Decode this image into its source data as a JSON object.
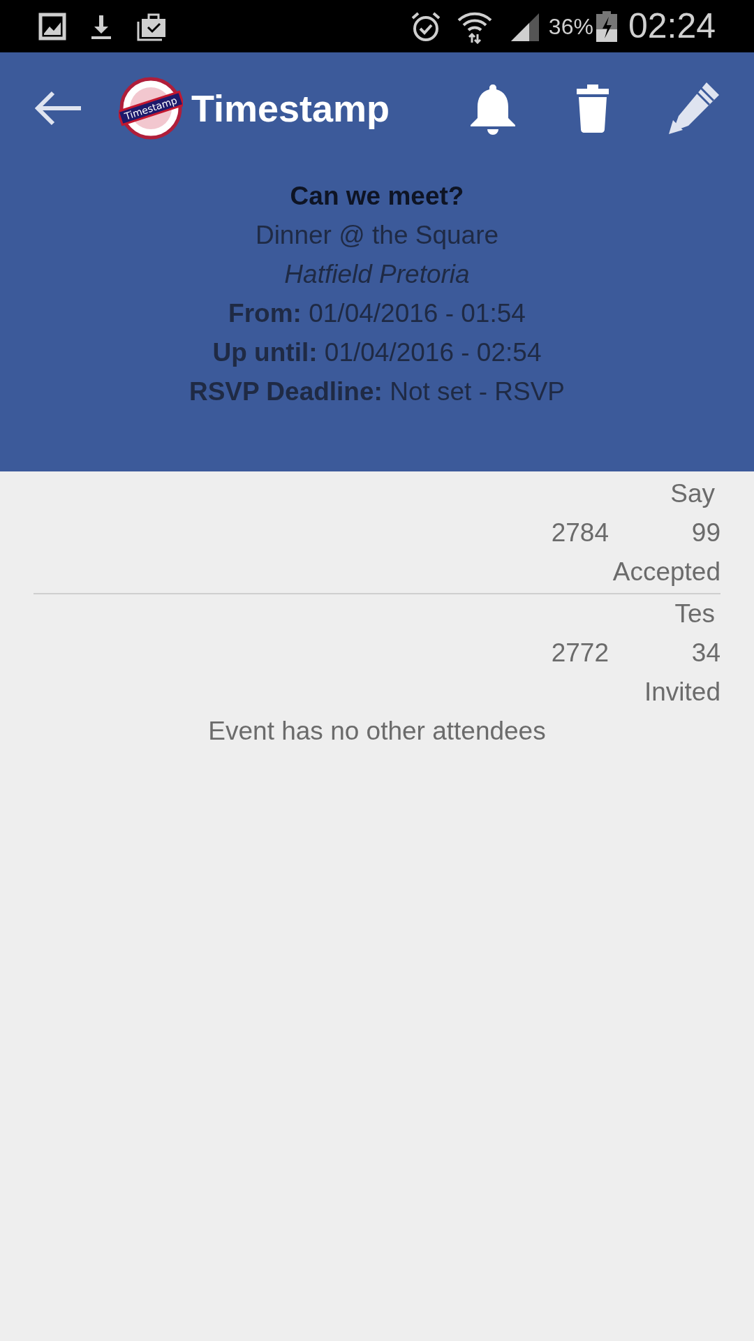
{
  "status_bar": {
    "battery": "36%",
    "time": "02:24"
  },
  "toolbar": {
    "logo_text": "Timestamp",
    "title": "Timestamp"
  },
  "event": {
    "question": "Can we meet?",
    "name": "Dinner @ the Square",
    "location": "Hatfield Pretoria",
    "details": [
      {
        "label": "From:",
        "value": "01/04/2016 - 01:54"
      },
      {
        "label": "Up until:",
        "value": "01/04/2016 - 02:54"
      },
      {
        "label": "RSVP Deadline:",
        "value": "Not set - RSVP"
      }
    ]
  },
  "attendees": [
    {
      "name": "Say",
      "number": "2784",
      "code": "99",
      "status": "Accepted"
    },
    {
      "name": "Tes",
      "number": "2772",
      "code": "34",
      "status": "Invited"
    }
  ],
  "empty_message": "Event has no other attendees"
}
